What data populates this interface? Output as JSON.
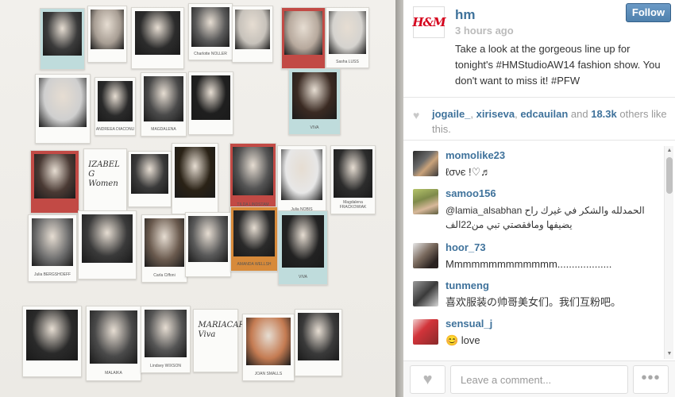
{
  "post": {
    "username": "hm",
    "logo_text": "H&M",
    "time": "3 hours ago",
    "follow_label": "Follow",
    "caption": "Take a look at the gorgeous line up for tonight's #HMStudioAW14 fashion show. You don't want to miss it! #PFW"
  },
  "photo": {
    "cards": [
      {
        "caption": "",
        "handwriting": ""
      },
      {
        "caption": "",
        "handwriting": ""
      },
      {
        "caption": "",
        "handwriting": ""
      },
      {
        "caption": "Charlotte NOLLER",
        "handwriting": ""
      },
      {
        "caption": "",
        "handwriting": ""
      },
      {
        "caption": "",
        "handwriting": ""
      },
      {
        "caption": "Sasha LUSS",
        "handwriting": ""
      },
      {
        "caption": "",
        "handwriting": ""
      },
      {
        "caption": "ANDREEA DIACONU",
        "handwriting": ""
      },
      {
        "caption": "MAGDALENA",
        "handwriting": ""
      },
      {
        "caption": "",
        "handwriting": ""
      },
      {
        "caption": "VIVA",
        "handwriting": ""
      },
      {
        "caption": "",
        "handwriting": ""
      },
      {
        "caption": "",
        "handwriting": "IZABEL G Women"
      },
      {
        "caption": "",
        "handwriting": ""
      },
      {
        "caption": "",
        "handwriting": ""
      },
      {
        "caption": "TILDA LINDSTAM",
        "handwriting": ""
      },
      {
        "caption": "Julia NOBIS",
        "handwriting": ""
      },
      {
        "caption": "Magdalena FRACKOWIAK",
        "handwriting": ""
      },
      {
        "caption": "Julia BERGSHOEFF",
        "handwriting": ""
      },
      {
        "caption": "",
        "handwriting": ""
      },
      {
        "caption": "Carla Ciffoni",
        "handwriting": ""
      },
      {
        "caption": "",
        "handwriting": ""
      },
      {
        "caption": "AMANDA WELLSH",
        "handwriting": ""
      },
      {
        "caption": "VIVA",
        "handwriting": ""
      },
      {
        "caption": "",
        "handwriting": ""
      },
      {
        "caption": "MALAIKA",
        "handwriting": ""
      },
      {
        "caption": "Lindsey WIXSON",
        "handwriting": ""
      },
      {
        "caption": "",
        "handwriting": "MARIACARLA Viva"
      },
      {
        "caption": "JOAN SMALLS",
        "handwriting": ""
      },
      {
        "caption": "",
        "handwriting": ""
      }
    ]
  },
  "likes": {
    "users": [
      "jogaile_",
      "xiriseva",
      "edcauilan"
    ],
    "separator": ", ",
    "and_text": " and ",
    "count_text": "18.3k",
    "suffix": " others like this."
  },
  "comments": [
    {
      "user": "momolike23",
      "text": "ℓσνє !♡♬"
    },
    {
      "user": "samoo156",
      "text": "@lamia_alsabhan الحمدلله والشكر في غيرك راح يضيفها ومافقصتي تبي من22الف"
    },
    {
      "user": "hoor_73",
      "text": "Mmmmmmmmmmmmm..................."
    },
    {
      "user": "tunmeng",
      "text": "喜欢服装の帅哥美女们。我们互粉吧。"
    },
    {
      "user": "sensual_j",
      "text": "😊 love"
    }
  ],
  "comment_box": {
    "placeholder": "Leave a comment..."
  },
  "icons": {
    "heart": "♥",
    "more": "•••",
    "scroll_up": "▲",
    "scroll_down": "▼"
  },
  "colors": {
    "username_blue": "#3f729b",
    "brand_red": "#d5001c",
    "follow_button": "#517fa4"
  }
}
